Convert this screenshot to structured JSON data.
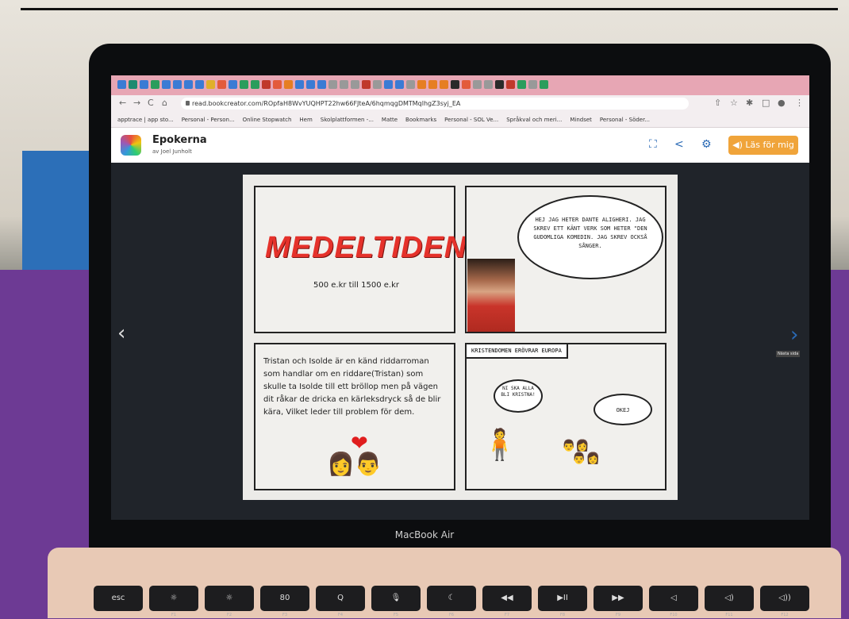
{
  "browser": {
    "url": "read.bookcreator.com/ROpfaH8WvYUQHPT22hw66FJteA/6hqmqgDMTMqlhgZ3syj_EA",
    "bookmarks": [
      "apptrace | app sto...",
      "Personal - Person...",
      "Online Stopwatch",
      "Hem",
      "Skolplattformen -...",
      "Matte",
      "Bookmarks",
      "Personal - SOL Ve...",
      "Språkval och meri...",
      "Mindset",
      "Personal - Söder..."
    ]
  },
  "app": {
    "title": "Epokerna",
    "author": "av Joel Junholt",
    "read_button": "◀) Läs för mig",
    "next_tooltip": "Nästa sida"
  },
  "book": {
    "title": "MEDELTIDEN",
    "subtitle": "500 e.kr till 1500 e.kr",
    "dante_speech": "HEJ JAG HETER DANTE ALIGHERI. JAG SKREV ETT KÄNT VERK SOM HETER \"DEN GUDOMLIGA KOMEDIN. JAG SKREV OCKSÅ SÅNGER.",
    "story": "Tristan och Isolde är en känd riddarroman som handlar om en riddare(Tristan) som skulle ta Isolde till ett bröllop men på vägen dit råkar de dricka en kärleksdryck så de blir kära, Vilket leder till problem för dem.",
    "caption": "KRISTENDOMEN ERÖVRAR EUROPA",
    "speech_1": "NI SKA ALLA BLI KRISTNA!",
    "speech_2": "OKEJ"
  },
  "laptop": {
    "brand": "MacBook Air"
  },
  "keys": [
    {
      "top": "esc",
      "fn": ""
    },
    {
      "top": "☼",
      "fn": "F1"
    },
    {
      "top": "☼",
      "fn": "F2"
    },
    {
      "top": "80",
      "fn": "F3"
    },
    {
      "top": "Q",
      "fn": "F4"
    },
    {
      "top": "🎙",
      "fn": "F5"
    },
    {
      "top": "☾",
      "fn": "F6"
    },
    {
      "top": "◀◀",
      "fn": "F7"
    },
    {
      "top": "▶II",
      "fn": "F8"
    },
    {
      "top": "▶▶",
      "fn": "F9"
    },
    {
      "top": "◁",
      "fn": "F10"
    },
    {
      "top": "◁)",
      "fn": "F11"
    },
    {
      "top": "◁))",
      "fn": "F12"
    }
  ]
}
